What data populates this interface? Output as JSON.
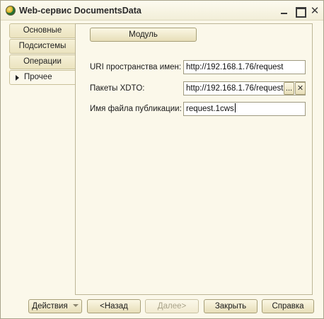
{
  "window": {
    "title": "Web-сервис DocumentsData",
    "controls": {
      "minimize": "",
      "maximize": "",
      "close": "✕"
    }
  },
  "sidebar": {
    "tabs": [
      {
        "label": "Основные",
        "active": false
      },
      {
        "label": "Подсистемы",
        "active": false
      },
      {
        "label": "Операции",
        "active": false
      },
      {
        "label": "Прочее",
        "active": true
      }
    ]
  },
  "main": {
    "module_button": "Модуль",
    "fields": [
      {
        "label": "URI пространства имен:",
        "value": "http://192.168.1.76/request"
      },
      {
        "label": "Пакеты XDTO:",
        "value": "http://192.168.1.76/request",
        "select_button": "...",
        "clear_button": "✕"
      },
      {
        "label": "Имя файла публикации:",
        "value": "request.1cws"
      }
    ]
  },
  "footer": {
    "actions": "Действия",
    "back": "<Назад",
    "next": "Далее>",
    "close": "Закрыть",
    "help": "Справка"
  }
}
